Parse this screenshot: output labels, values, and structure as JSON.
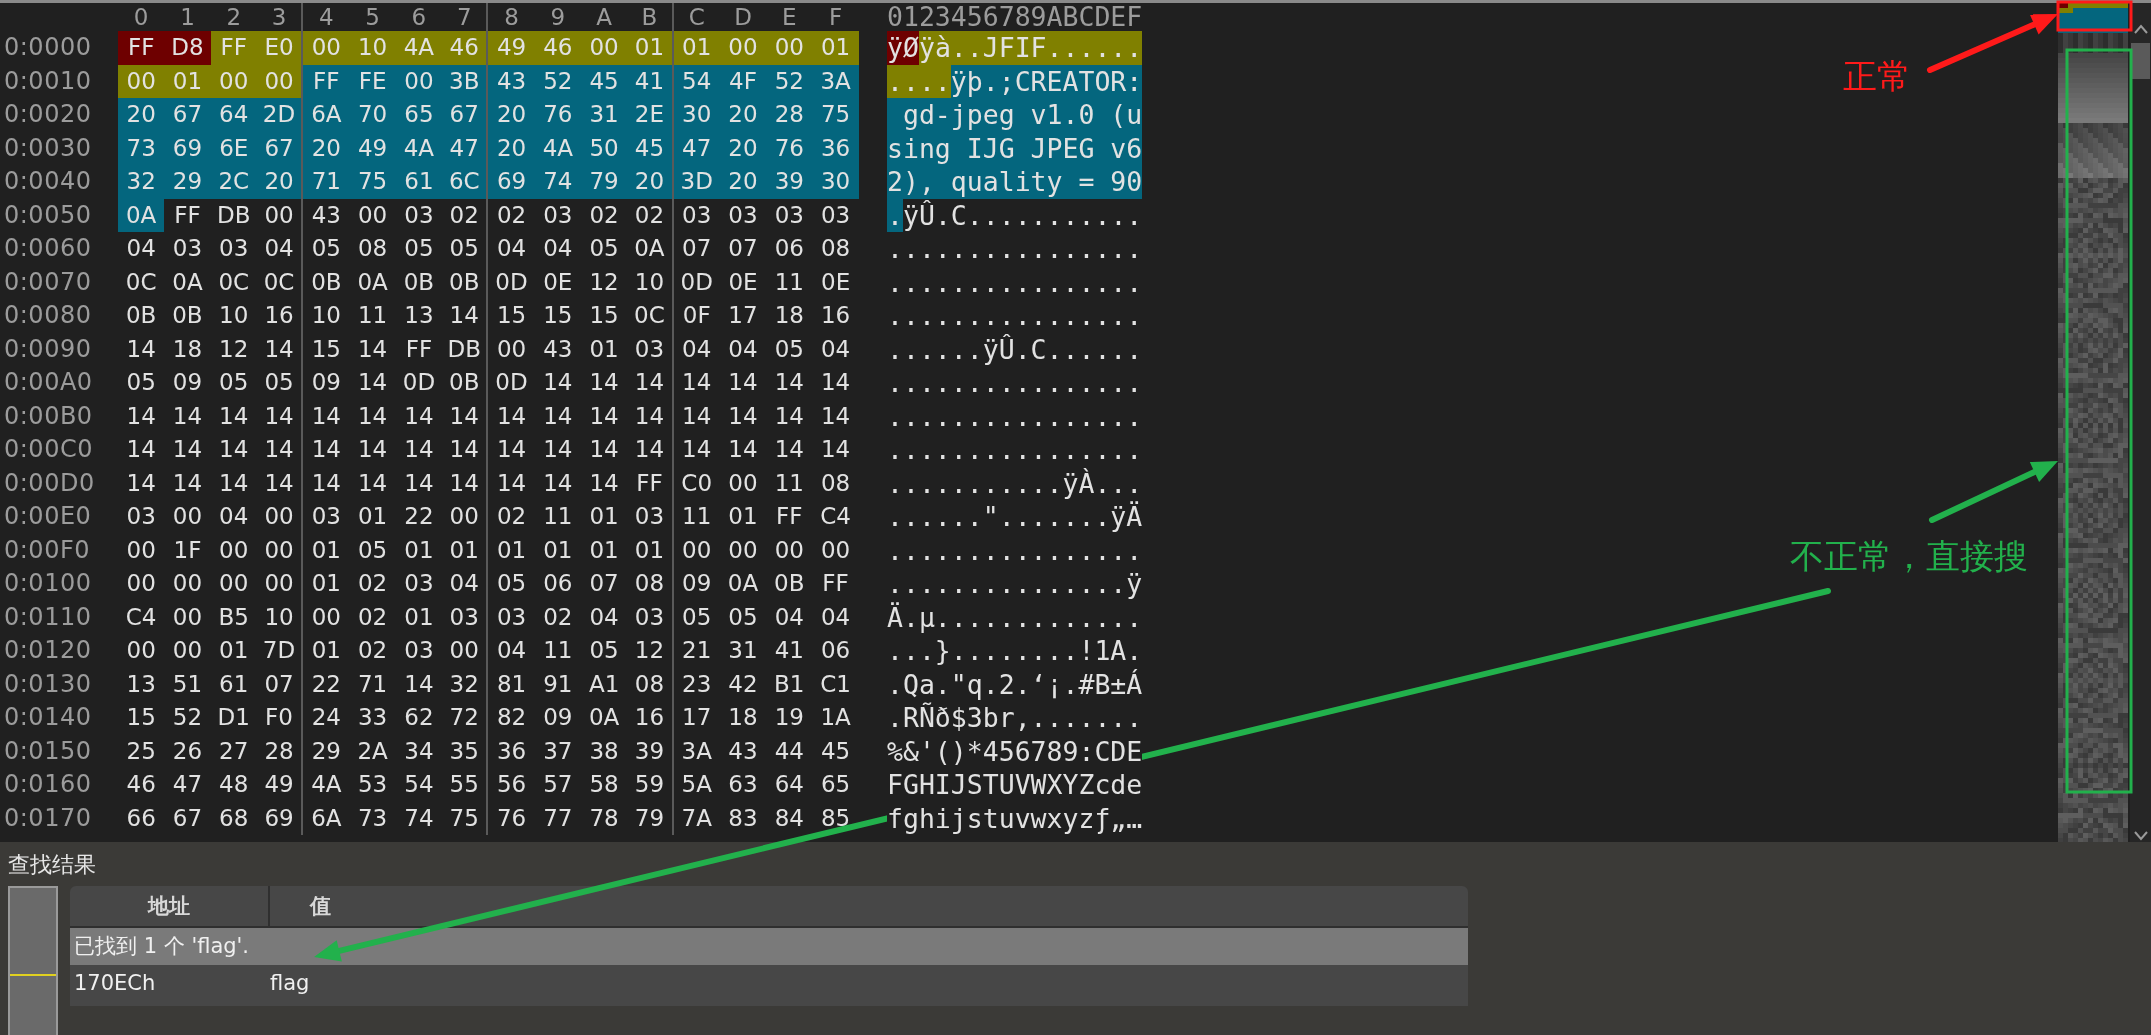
{
  "hex_view": {
    "columns": [
      "0",
      "1",
      "2",
      "3",
      "4",
      "5",
      "6",
      "7",
      "8",
      "9",
      "A",
      "B",
      "C",
      "D",
      "E",
      "F"
    ],
    "ascii_header": "0123456789ABCDEF",
    "rows": [
      {
        "offset": "0:0000",
        "segments": [
          {
            "color": "#6e0000",
            "bytes": [
              "FF",
              "D8"
            ],
            "ascii": "ÿØ"
          },
          {
            "color": "#808000",
            "bytes": [
              "FF",
              "E0",
              "00",
              "10",
              "4A",
              "46",
              "49",
              "46",
              "00",
              "01",
              "01",
              "00",
              "00",
              "01"
            ],
            "ascii": "ÿà..JFIF......"
          }
        ]
      },
      {
        "offset": "0:0010",
        "segments": [
          {
            "color": "#808000",
            "bytes": [
              "00",
              "01",
              "00",
              "00"
            ],
            "ascii": "...."
          },
          {
            "color": "#04667e",
            "bytes": [
              "FF",
              "FE",
              "00",
              "3B",
              "43",
              "52",
              "45",
              "41",
              "54",
              "4F",
              "52",
              "3A"
            ],
            "ascii": "ÿþ.;CREATOR:"
          }
        ]
      },
      {
        "offset": "0:0020",
        "segments": [
          {
            "color": "#04667e",
            "bytes": [
              "20",
              "67",
              "64",
              "2D",
              "6A",
              "70",
              "65",
              "67",
              "20",
              "76",
              "31",
              "2E",
              "30",
              "20",
              "28",
              "75"
            ],
            "ascii": " gd-jpeg v1.0 (u"
          }
        ]
      },
      {
        "offset": "0:0030",
        "segments": [
          {
            "color": "#04667e",
            "bytes": [
              "73",
              "69",
              "6E",
              "67",
              "20",
              "49",
              "4A",
              "47",
              "20",
              "4A",
              "50",
              "45",
              "47",
              "20",
              "76",
              "36"
            ],
            "ascii": "sing IJG JPEG v6"
          }
        ]
      },
      {
        "offset": "0:0040",
        "segments": [
          {
            "color": "#04667e",
            "bytes": [
              "32",
              "29",
              "2C",
              "20",
              "71",
              "75",
              "61",
              "6C",
              "69",
              "74",
              "79",
              "20",
              "3D",
              "20",
              "39",
              "30"
            ],
            "ascii": "2), quality = 90"
          }
        ]
      },
      {
        "offset": "0:0050",
        "segments": [
          {
            "color": "#04667e",
            "bytes": [
              "0A"
            ],
            "ascii": "."
          },
          {
            "bytes": [
              "FF",
              "DB",
              "00",
              "43",
              "00",
              "03",
              "02",
              "02",
              "03",
              "02",
              "02",
              "03",
              "03",
              "03",
              "03"
            ],
            "ascii": "ÿÛ.C..........."
          }
        ]
      },
      {
        "offset": "0:0060",
        "segments": [
          {
            "bytes": [
              "04",
              "03",
              "03",
              "04",
              "05",
              "08",
              "05",
              "05",
              "04",
              "04",
              "05",
              "0A",
              "07",
              "07",
              "06",
              "08"
            ],
            "ascii": "................"
          }
        ]
      },
      {
        "offset": "0:0070",
        "segments": [
          {
            "bytes": [
              "0C",
              "0A",
              "0C",
              "0C",
              "0B",
              "0A",
              "0B",
              "0B",
              "0D",
              "0E",
              "12",
              "10",
              "0D",
              "0E",
              "11",
              "0E"
            ],
            "ascii": "................"
          }
        ]
      },
      {
        "offset": "0:0080",
        "segments": [
          {
            "bytes": [
              "0B",
              "0B",
              "10",
              "16",
              "10",
              "11",
              "13",
              "14",
              "15",
              "15",
              "15",
              "0C",
              "0F",
              "17",
              "18",
              "16"
            ],
            "ascii": "................"
          }
        ]
      },
      {
        "offset": "0:0090",
        "segments": [
          {
            "bytes": [
              "14",
              "18",
              "12",
              "14",
              "15",
              "14",
              "FF",
              "DB",
              "00",
              "43",
              "01",
              "03",
              "04",
              "04",
              "05",
              "04"
            ],
            "ascii": "......ÿÛ.C......"
          }
        ]
      },
      {
        "offset": "0:00A0",
        "segments": [
          {
            "bytes": [
              "05",
              "09",
              "05",
              "05",
              "09",
              "14",
              "0D",
              "0B",
              "0D",
              "14",
              "14",
              "14",
              "14",
              "14",
              "14",
              "14"
            ],
            "ascii": "................"
          }
        ]
      },
      {
        "offset": "0:00B0",
        "segments": [
          {
            "bytes": [
              "14",
              "14",
              "14",
              "14",
              "14",
              "14",
              "14",
              "14",
              "14",
              "14",
              "14",
              "14",
              "14",
              "14",
              "14",
              "14"
            ],
            "ascii": "................"
          }
        ]
      },
      {
        "offset": "0:00C0",
        "segments": [
          {
            "bytes": [
              "14",
              "14",
              "14",
              "14",
              "14",
              "14",
              "14",
              "14",
              "14",
              "14",
              "14",
              "14",
              "14",
              "14",
              "14",
              "14"
            ],
            "ascii": "................"
          }
        ]
      },
      {
        "offset": "0:00D0",
        "segments": [
          {
            "bytes": [
              "14",
              "14",
              "14",
              "14",
              "14",
              "14",
              "14",
              "14",
              "14",
              "14",
              "14",
              "FF",
              "C0",
              "00",
              "11",
              "08"
            ],
            "ascii": "...........ÿÀ..."
          }
        ]
      },
      {
        "offset": "0:00E0",
        "segments": [
          {
            "bytes": [
              "03",
              "00",
              "04",
              "00",
              "03",
              "01",
              "22",
              "00",
              "02",
              "11",
              "01",
              "03",
              "11",
              "01",
              "FF",
              "C4"
            ],
            "ascii": "......\".......ÿÄ"
          }
        ]
      },
      {
        "offset": "0:00F0",
        "segments": [
          {
            "bytes": [
              "00",
              "1F",
              "00",
              "00",
              "01",
              "05",
              "01",
              "01",
              "01",
              "01",
              "01",
              "01",
              "00",
              "00",
              "00",
              "00"
            ],
            "ascii": "................"
          }
        ]
      },
      {
        "offset": "0:0100",
        "segments": [
          {
            "bytes": [
              "00",
              "00",
              "00",
              "00",
              "01",
              "02",
              "03",
              "04",
              "05",
              "06",
              "07",
              "08",
              "09",
              "0A",
              "0B",
              "FF"
            ],
            "ascii": "...............ÿ"
          }
        ]
      },
      {
        "offset": "0:0110",
        "segments": [
          {
            "bytes": [
              "C4",
              "00",
              "B5",
              "10",
              "00",
              "02",
              "01",
              "03",
              "03",
              "02",
              "04",
              "03",
              "05",
              "05",
              "04",
              "04"
            ],
            "ascii": "Ä.µ............."
          }
        ]
      },
      {
        "offset": "0:0120",
        "segments": [
          {
            "bytes": [
              "00",
              "00",
              "01",
              "7D",
              "01",
              "02",
              "03",
              "00",
              "04",
              "11",
              "05",
              "12",
              "21",
              "31",
              "41",
              "06"
            ],
            "ascii": "...}........!1A."
          }
        ]
      },
      {
        "offset": "0:0130",
        "segments": [
          {
            "bytes": [
              "13",
              "51",
              "61",
              "07",
              "22",
              "71",
              "14",
              "32",
              "81",
              "91",
              "A1",
              "08",
              "23",
              "42",
              "B1",
              "C1"
            ],
            "ascii": ".Qa.\"q.2.‘¡.#B±Á"
          }
        ]
      },
      {
        "offset": "0:0140",
        "segments": [
          {
            "bytes": [
              "15",
              "52",
              "D1",
              "F0",
              "24",
              "33",
              "62",
              "72",
              "82",
              "09",
              "0A",
              "16",
              "17",
              "18",
              "19",
              "1A"
            ],
            "ascii": ".RÑð$3br‚......."
          }
        ]
      },
      {
        "offset": "0:0150",
        "segments": [
          {
            "bytes": [
              "25",
              "26",
              "27",
              "28",
              "29",
              "2A",
              "34",
              "35",
              "36",
              "37",
              "38",
              "39",
              "3A",
              "43",
              "44",
              "45"
            ],
            "ascii": "%&'()*456789:CDE"
          }
        ]
      },
      {
        "offset": "0:0160",
        "segments": [
          {
            "bytes": [
              "46",
              "47",
              "48",
              "49",
              "4A",
              "53",
              "54",
              "55",
              "56",
              "57",
              "58",
              "59",
              "5A",
              "63",
              "64",
              "65"
            ],
            "ascii": "FGHIJSTUVWXYZcde"
          }
        ]
      },
      {
        "offset": "0:0170",
        "segments": [
          {
            "bytes": [
              "66",
              "67",
              "68",
              "69",
              "6A",
              "73",
              "74",
              "75",
              "76",
              "77",
              "78",
              "79",
              "7A",
              "83",
              "84",
              "85"
            ],
            "ascii": "fghijstuvwxyzƒ„…"
          }
        ]
      }
    ]
  },
  "search_results": {
    "title": "查找结果",
    "columns": [
      "地址",
      "值"
    ],
    "rows": [
      {
        "kind": "summary",
        "selected": true,
        "text": "已找到 1 个 'flag'."
      },
      {
        "kind": "match",
        "selected": false,
        "address": "170ECh",
        "value": "flag"
      }
    ]
  },
  "callouts": [
    {
      "text": "正常",
      "color": "#ff1a1a"
    },
    {
      "text": "不正常，直接搜",
      "color": "#22b14c"
    }
  ]
}
